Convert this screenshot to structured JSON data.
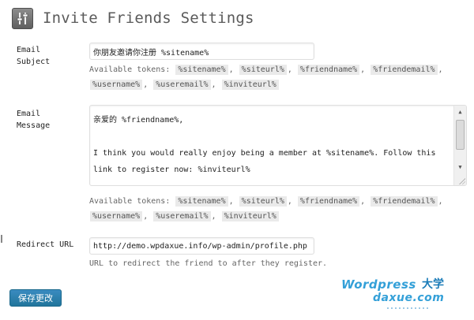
{
  "page": {
    "title": "Invite Friends Settings",
    "icon": "settings-sliders-icon"
  },
  "email_subject": {
    "label": "Email\nSubject",
    "value": "你朋友邀请你注册 %sitename%",
    "tokens_prefix": "Available tokens:",
    "tokens": [
      "%sitename%",
      "%siteurl%",
      "%friendname%",
      "%friendemail%",
      "%username%",
      "%useremail%",
      "%inviteurl%"
    ]
  },
  "email_message": {
    "label": "Email\nMessage",
    "value": "亲爱的 %friendname%,\n\nI think you would really enjoy being a member at %sitename%. Follow this link to register now: %inviteurl%",
    "tokens_prefix": "Available tokens:",
    "tokens": [
      "%sitename%",
      "%siteurl%",
      "%friendname%",
      "%friendemail%",
      "%username%",
      "%useremail%",
      "%inviteurl%"
    ]
  },
  "redirect_url": {
    "label": "Redirect URL",
    "value": "http://demo.wpdaxue.info/wp-admin/profile.php",
    "hint": "URL to redirect the friend to after they register."
  },
  "save_button": {
    "label": "保存更改"
  },
  "watermark": {
    "line1": "Wordpress",
    "line2": "daxue.com",
    "badge": "大学"
  },
  "colors": {
    "primary_button": "#21759b",
    "token_bg": "#eaeaea",
    "watermark": "#34a0d8"
  }
}
